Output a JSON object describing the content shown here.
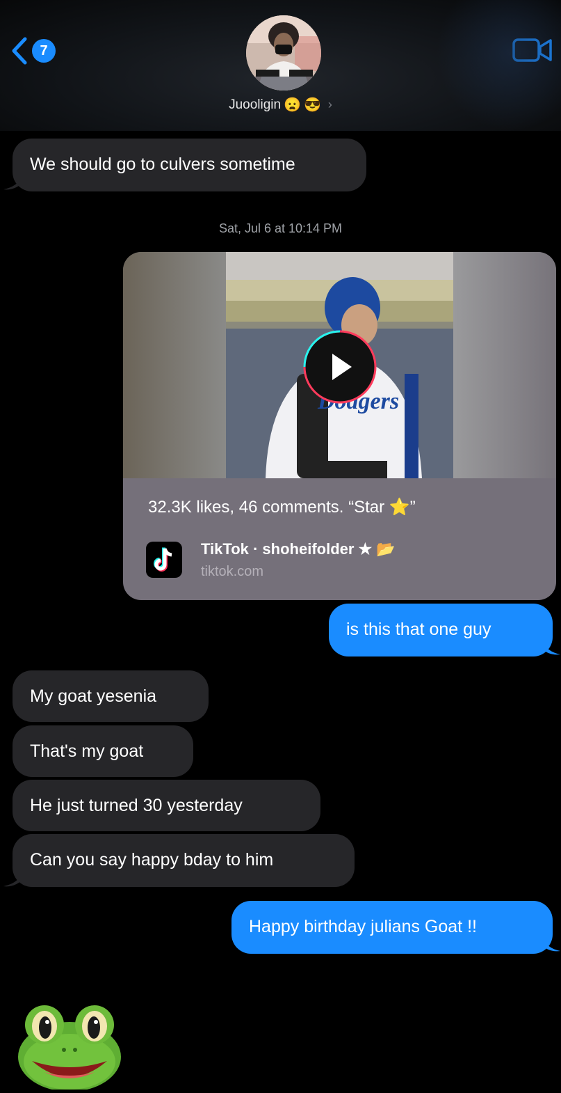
{
  "header": {
    "back_count": "7",
    "contact_name": "Juooligin",
    "contact_emojis": [
      "😦",
      "😎"
    ],
    "chevron": "›"
  },
  "messages": [
    {
      "side": "in",
      "text": "We should go to culvers sometime"
    },
    {
      "side": "out",
      "text": "is this that one guy"
    },
    {
      "side": "in",
      "text": "My goat yesenia"
    },
    {
      "side": "in",
      "text": "That's my goat"
    },
    {
      "side": "in",
      "text": "He just turned 30 yesterday"
    },
    {
      "side": "in",
      "text": "Can you say happy bday to him"
    },
    {
      "side": "out",
      "text": "Happy birthday julians Goat !!"
    }
  ],
  "timestamp": "Sat, Jul 6 at 10:14 PM",
  "link_card": {
    "description": "32.3K likes, 46 comments. “Star ⭐”",
    "title": "TikTok · shoheifolder ★ 📂",
    "domain": "tiktok.com"
  },
  "sticker": "🐸",
  "colors": {
    "outgoing": "#1a8cff",
    "incoming": "#262629",
    "card": "#75707a",
    "accent": "#1a8cff"
  },
  "icons": [
    "back-chevron-icon",
    "video-camera-icon",
    "play-icon",
    "tiktok-icon",
    "frog-sticker"
  ]
}
